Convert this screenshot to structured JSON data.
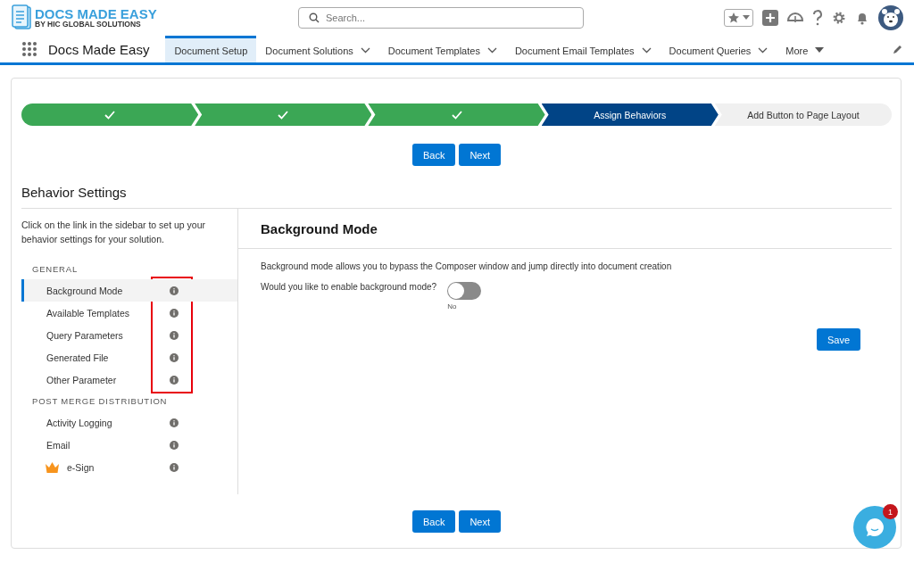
{
  "header": {
    "logo_title": "DOCS MADE EASY",
    "logo_subtitle": "BY HIC GLOBAL SOLUTIONS",
    "search": {
      "placeholder": "Search..."
    }
  },
  "nav": {
    "app_name": "Docs Made Easy",
    "tabs": [
      {
        "label": "Document Setup",
        "selected": true,
        "kind": "plain"
      },
      {
        "label": "Document Solutions",
        "selected": false,
        "kind": "dropdown"
      },
      {
        "label": "Document Templates",
        "selected": false,
        "kind": "dropdown"
      },
      {
        "label": "Document Email Templates",
        "selected": false,
        "kind": "dropdown"
      },
      {
        "label": "Document Queries",
        "selected": false,
        "kind": "dropdown"
      },
      {
        "label": "More",
        "selected": false,
        "kind": "overflow"
      }
    ]
  },
  "path": [
    {
      "complete": true,
      "selected": false
    },
    {
      "complete": true,
      "selected": false
    },
    {
      "complete": true,
      "selected": false
    },
    {
      "label": "Assign Behaviors",
      "complete": false,
      "selected": true
    },
    {
      "label": "Add Button to Page Layout",
      "complete": false,
      "selected": false
    }
  ],
  "top_buttons": [
    "Back",
    "Next"
  ],
  "section_title": "Behavior Settings",
  "sidebar": {
    "intro": "Click on the link in the sidebar to set up your behavior settings for your solution.",
    "groups": [
      {
        "heading": "GENERAL",
        "highlighted": true,
        "items": [
          {
            "label": "Background Mode",
            "selected": true,
            "premium": false
          },
          {
            "label": "Available Templates",
            "selected": false,
            "premium": false
          },
          {
            "label": "Query Parameters",
            "selected": false,
            "premium": false
          },
          {
            "label": "Generated File",
            "selected": false,
            "premium": false
          },
          {
            "label": "Other Parameter",
            "selected": false,
            "premium": false
          }
        ]
      },
      {
        "heading": "POST MERGE DISTRIBUTION",
        "highlighted": false,
        "items": [
          {
            "label": "Activity Logging",
            "selected": false,
            "premium": false
          },
          {
            "label": "Email",
            "selected": false,
            "premium": false
          },
          {
            "label": "e-Sign",
            "selected": false,
            "premium": true
          }
        ]
      }
    ]
  },
  "detail": {
    "title": "Background Mode",
    "description": "Background mode allows you to bypass the Composer window and jump directly into document creation",
    "question": "Would you like to enable background mode?",
    "toggle": {
      "on": false,
      "caption": "No"
    },
    "save": "Save"
  },
  "bottom_buttons": [
    "Back",
    "Next"
  ],
  "chat": {
    "badge": "1"
  }
}
